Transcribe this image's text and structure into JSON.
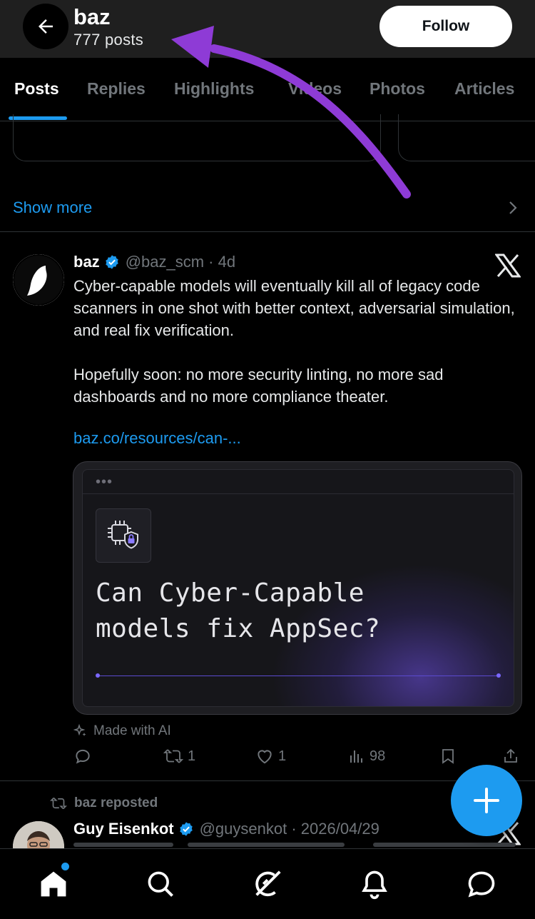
{
  "header": {
    "profile_name": "baz",
    "post_count": "777 posts",
    "follow_label": "Follow"
  },
  "tabs": [
    {
      "label": "Posts",
      "active": true
    },
    {
      "label": "Replies"
    },
    {
      "label": "Highlights"
    },
    {
      "label": "Videos"
    },
    {
      "label": "Photos"
    },
    {
      "label": "Articles"
    }
  ],
  "show_more": "Show more",
  "tweet": {
    "name": "baz",
    "handle": "@baz_scm · 4d",
    "body_p1": "Cyber-capable models will eventually kill all of legacy code scanners in one shot with better context, adversarial simulation, and real fix verification.",
    "body_p2": "Hopefully soon: no more security linting, no more sad dashboards and no more compliance theater.",
    "link": "baz.co/resources/can-...",
    "card": {
      "dots": "•••",
      "title_line1": "Can Cyber-Capable",
      "title_line2": "models fix AppSec?"
    },
    "ai_note": "Made with AI",
    "actions": {
      "replies": "",
      "reposts": "1",
      "likes": "1",
      "views": "98"
    }
  },
  "repost": {
    "repost_label": "baz reposted",
    "name": "Guy Eisenkot",
    "handle": "@guysenkot · 2026/04/29"
  },
  "colors": {
    "accent": "#1d9bf0",
    "annotation_arrow": "#8e3bd6",
    "muted": "#71767b"
  },
  "icons": [
    "back-arrow-icon",
    "x-logo-icon",
    "verified-badge-icon",
    "reply-icon",
    "repost-icon",
    "like-icon",
    "views-icon",
    "bookmark-icon",
    "share-icon",
    "sparkle-icon",
    "plus-icon",
    "home-icon",
    "search-icon",
    "grok-icon",
    "bell-icon",
    "messages-icon",
    "chevron-right-icon"
  ]
}
